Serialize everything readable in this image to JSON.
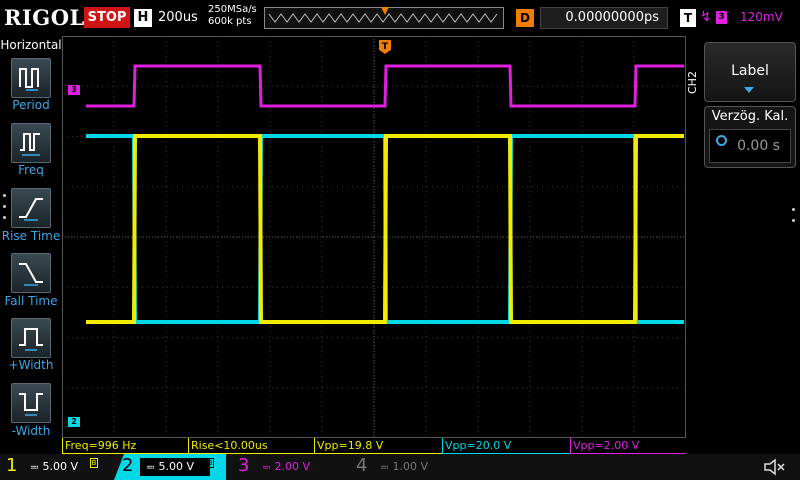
{
  "topbar": {
    "brand": "RIGOL",
    "run_state": "STOP",
    "horizontal_badge": "H",
    "timebase": "200us",
    "sample_rate": "250MSa/s",
    "memory_depth": "600k pts",
    "delay_badge": "D",
    "delay_value": "0.00000000ps",
    "trigger_badge": "T",
    "trigger_edge_symbol": "↯",
    "trigger_channel": "3",
    "trigger_level": "120mV"
  },
  "left_menu": {
    "title": "Horizontal",
    "items": [
      {
        "label": "Period",
        "icon": "period-icon"
      },
      {
        "label": "Freq",
        "icon": "freq-icon"
      },
      {
        "label": "Rise Time",
        "icon": "rise-time-icon"
      },
      {
        "label": "Fall Time",
        "icon": "fall-time-icon"
      },
      {
        "label": "+Width",
        "icon": "positive-width-icon"
      },
      {
        "label": "-Width",
        "icon": "negative-width-icon"
      }
    ]
  },
  "right_menu": {
    "channel_tag": "CH2",
    "label_button": "Label",
    "delay_cal_title": "Verzög. Kal.",
    "delay_cal_value": "0.00 s"
  },
  "plot": {
    "trigger_marker": "T",
    "ch3_marker": "3",
    "ch2_marker": "2"
  },
  "measurements": [
    {
      "text": "Freq=996 Hz",
      "color": "#f2ec00"
    },
    {
      "text": "Rise<10.00us",
      "color": "#f2ec00"
    },
    {
      "text": "Vpp=19.8 V",
      "color": "#f2ec00"
    },
    {
      "text": "Vpp=20.0 V",
      "color": "#00d8e8"
    },
    {
      "text": "Vpp=2.00 V",
      "color": "#e01fe0"
    }
  ],
  "channels": [
    {
      "num": "1",
      "coupling": "≕",
      "scale": "5.00 V",
      "color": "#f2ec00",
      "active": true
    },
    {
      "num": "2",
      "coupling": "≕",
      "scale": "5.00 V",
      "color": "#00d8e8",
      "active": true
    },
    {
      "num": "3",
      "coupling": "≕",
      "scale": "2.00 V",
      "color": "#e01fe0",
      "active": true
    },
    {
      "num": "4",
      "coupling": "≕",
      "scale": "1.00 V",
      "color": "#777777",
      "active": false
    }
  ],
  "colors": {
    "ch1": "#f2ec00",
    "ch2": "#00d8e8",
    "ch3": "#e01fe0",
    "trigger": "#f07c00",
    "menu_text": "#3ba9e8"
  }
}
